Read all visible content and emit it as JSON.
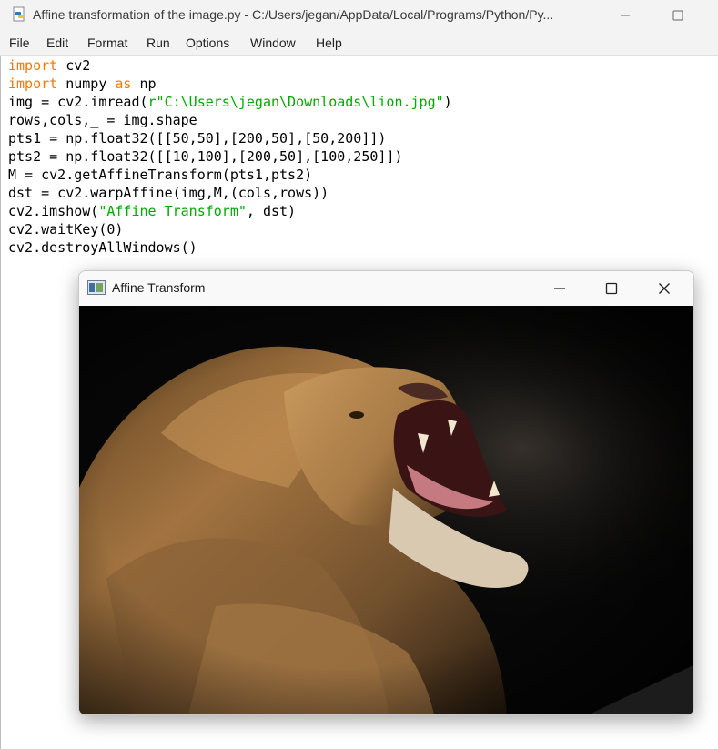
{
  "idle": {
    "title": "Affine transformation of the image.py - C:/Users/jegan/AppData/Local/Programs/Python/Py...",
    "menu": [
      "File",
      "Edit",
      "Format",
      "Run",
      "Options",
      "Window",
      "Help"
    ],
    "code": [
      [
        {
          "t": "import",
          "c": "kw"
        },
        {
          "t": " cv2",
          "c": ""
        }
      ],
      [
        {
          "t": "import",
          "c": "kw"
        },
        {
          "t": " numpy ",
          "c": ""
        },
        {
          "t": "as",
          "c": "kw"
        },
        {
          "t": " np",
          "c": ""
        }
      ],
      [
        {
          "t": "img = cv2.imread(",
          "c": ""
        },
        {
          "t": "r\"C:\\Users\\jegan\\Downloads\\lion.jpg\"",
          "c": "str"
        },
        {
          "t": ")",
          "c": ""
        }
      ],
      [
        {
          "t": "rows,cols,_ = img.shape",
          "c": ""
        }
      ],
      [
        {
          "t": "pts1 = np.float32([[50,50],[200,50],[50,200]])",
          "c": ""
        }
      ],
      [
        {
          "t": "pts2 = np.float32([[10,100],[200,50],[100,250]])",
          "c": ""
        }
      ],
      [
        {
          "t": "M = cv2.getAffineTransform(pts1,pts2)",
          "c": ""
        }
      ],
      [
        {
          "t": "dst = cv2.warpAffine(img,M,(cols,rows))",
          "c": ""
        }
      ],
      [
        {
          "t": "cv2.imshow(",
          "c": ""
        },
        {
          "t": "\"Affine Transform\"",
          "c": "str"
        },
        {
          "t": ", dst)",
          "c": ""
        }
      ],
      [
        {
          "t": "cv2.waitKey(0)",
          "c": ""
        }
      ],
      [
        {
          "t": "cv2.destroyAllWindows()",
          "c": ""
        }
      ]
    ]
  },
  "cv_window": {
    "title": "Affine Transform"
  },
  "colors": {
    "keyword": "#ff7700",
    "string": "#00aa00",
    "background_black": "#070707"
  }
}
